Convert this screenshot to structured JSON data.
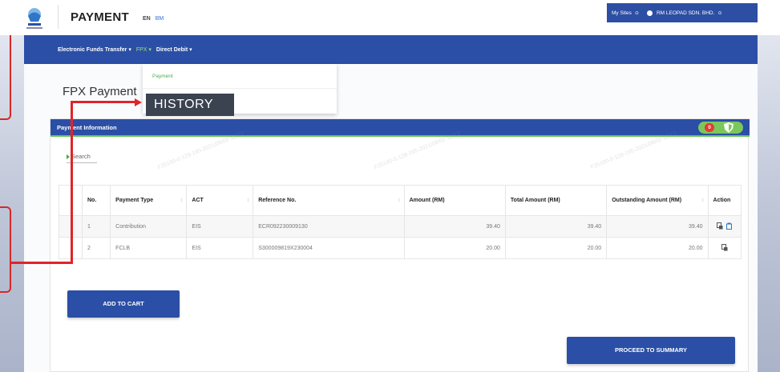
{
  "header": {
    "app_title": "PAYMENT",
    "lang_en": "EN",
    "lang_bm": "BM",
    "my_sites": "My Sites",
    "company": "RM LEOPAD SDN. BHD."
  },
  "nav": {
    "items": [
      {
        "label": "Electronic Funds Transfer",
        "arrow": "▾"
      },
      {
        "label": "FPX",
        "arrow": "▾"
      },
      {
        "label": "Direct Debit",
        "arrow": "▾"
      }
    ],
    "dropdown_item": "Payment"
  },
  "page_title": "FPX Payment",
  "callout": "HISTORY",
  "panel": {
    "title": "Payment Information",
    "badge_count": "0",
    "search_label": "Search"
  },
  "table": {
    "headers": [
      "No.",
      "Payment Type",
      "ACT",
      "Reference No.",
      "Amount (RM)",
      "Total Amount (RM)",
      "Outstanding Amount (RM)",
      "Action"
    ],
    "rows": [
      {
        "no": "1",
        "type": "Contribution",
        "act": "EIS",
        "ref": "ECR092230009130",
        "amount": "39.40",
        "total": "39.40",
        "outstanding": "39.40"
      },
      {
        "no": "2",
        "type": "FCLB",
        "act": "EIS",
        "ref": "S300009819X230004",
        "amount": "20.00",
        "total": "20.00",
        "outstanding": "20.00"
      }
    ]
  },
  "buttons": {
    "add_to_cart": "ADD TO CART",
    "proceed": "PROCEED TO SUMMARY"
  },
  "colors": {
    "primary": "#2b4fa6",
    "accent_green": "#7bc85a",
    "alert_red": "#e0242a"
  }
}
